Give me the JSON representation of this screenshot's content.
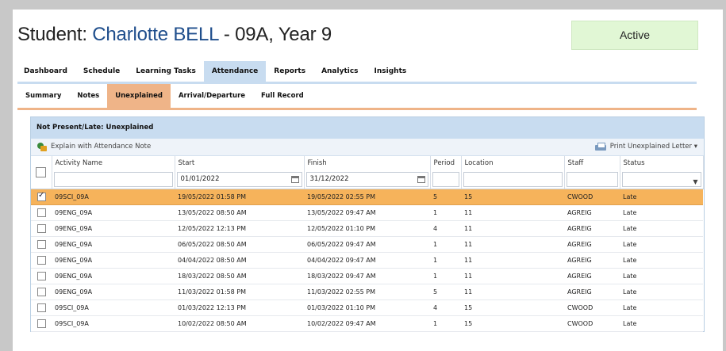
{
  "student": {
    "label": "Student: ",
    "name": "Charlotte BELL",
    "suffix": " - 09A, Year 9",
    "status": "Active"
  },
  "tabs": [
    "Dashboard",
    "Schedule",
    "Learning Tasks",
    "Attendance",
    "Reports",
    "Analytics",
    "Insights"
  ],
  "active_tab": "Attendance",
  "subtabs": [
    "Summary",
    "Notes",
    "Unexplained",
    "Arrival/Departure",
    "Full Record"
  ],
  "active_subtab": "Unexplained",
  "panel": {
    "title": "Not Present/Late: Unexplained",
    "explain_label": "Explain with Attendance Note",
    "print_label": "Print Unexplained Letter ▾"
  },
  "columns": {
    "activity": "Activity Name",
    "start": "Start",
    "finish": "Finish",
    "period": "Period",
    "location": "Location",
    "staff": "Staff",
    "status": "Status"
  },
  "filters": {
    "start": "01/01/2022",
    "finish": "31/12/2022",
    "status_dropdown": "⌵"
  },
  "rows": [
    {
      "checked": true,
      "activity": "09SCI_09A",
      "start": "19/05/2022 01:58 PM",
      "finish": "19/05/2022 02:55 PM",
      "period": "5",
      "location": "15",
      "staff": "CWOOD",
      "status": "Late"
    },
    {
      "checked": false,
      "activity": "09ENG_09A",
      "start": "13/05/2022 08:50 AM",
      "finish": "13/05/2022 09:47 AM",
      "period": "1",
      "location": "11",
      "staff": "AGREIG",
      "status": "Late"
    },
    {
      "checked": false,
      "activity": "09ENG_09A",
      "start": "12/05/2022 12:13 PM",
      "finish": "12/05/2022 01:10 PM",
      "period": "4",
      "location": "11",
      "staff": "AGREIG",
      "status": "Late"
    },
    {
      "checked": false,
      "activity": "09ENG_09A",
      "start": "06/05/2022 08:50 AM",
      "finish": "06/05/2022 09:47 AM",
      "period": "1",
      "location": "11",
      "staff": "AGREIG",
      "status": "Late"
    },
    {
      "checked": false,
      "activity": "09ENG_09A",
      "start": "04/04/2022 08:50 AM",
      "finish": "04/04/2022 09:47 AM",
      "period": "1",
      "location": "11",
      "staff": "AGREIG",
      "status": "Late"
    },
    {
      "checked": false,
      "activity": "09ENG_09A",
      "start": "18/03/2022 08:50 AM",
      "finish": "18/03/2022 09:47 AM",
      "period": "1",
      "location": "11",
      "staff": "AGREIG",
      "status": "Late"
    },
    {
      "checked": false,
      "activity": "09ENG_09A",
      "start": "11/03/2022 01:58 PM",
      "finish": "11/03/2022 02:55 PM",
      "period": "5",
      "location": "11",
      "staff": "AGREIG",
      "status": "Late"
    },
    {
      "checked": false,
      "activity": "09SCI_09A",
      "start": "01/03/2022 12:13 PM",
      "finish": "01/03/2022 01:10 PM",
      "period": "4",
      "location": "15",
      "staff": "CWOOD",
      "status": "Late"
    },
    {
      "checked": false,
      "activity": "09SCI_09A",
      "start": "10/02/2022 08:50 AM",
      "finish": "10/02/2022 09:47 AM",
      "period": "1",
      "location": "15",
      "staff": "CWOOD",
      "status": "Late"
    }
  ],
  "colors": {
    "student_name": "#1f4e8c",
    "status_box": "#e1f7d5",
    "active_tab": "#c8dcf0",
    "active_subtab": "#efb488",
    "selected_row": "#f6b35b"
  }
}
